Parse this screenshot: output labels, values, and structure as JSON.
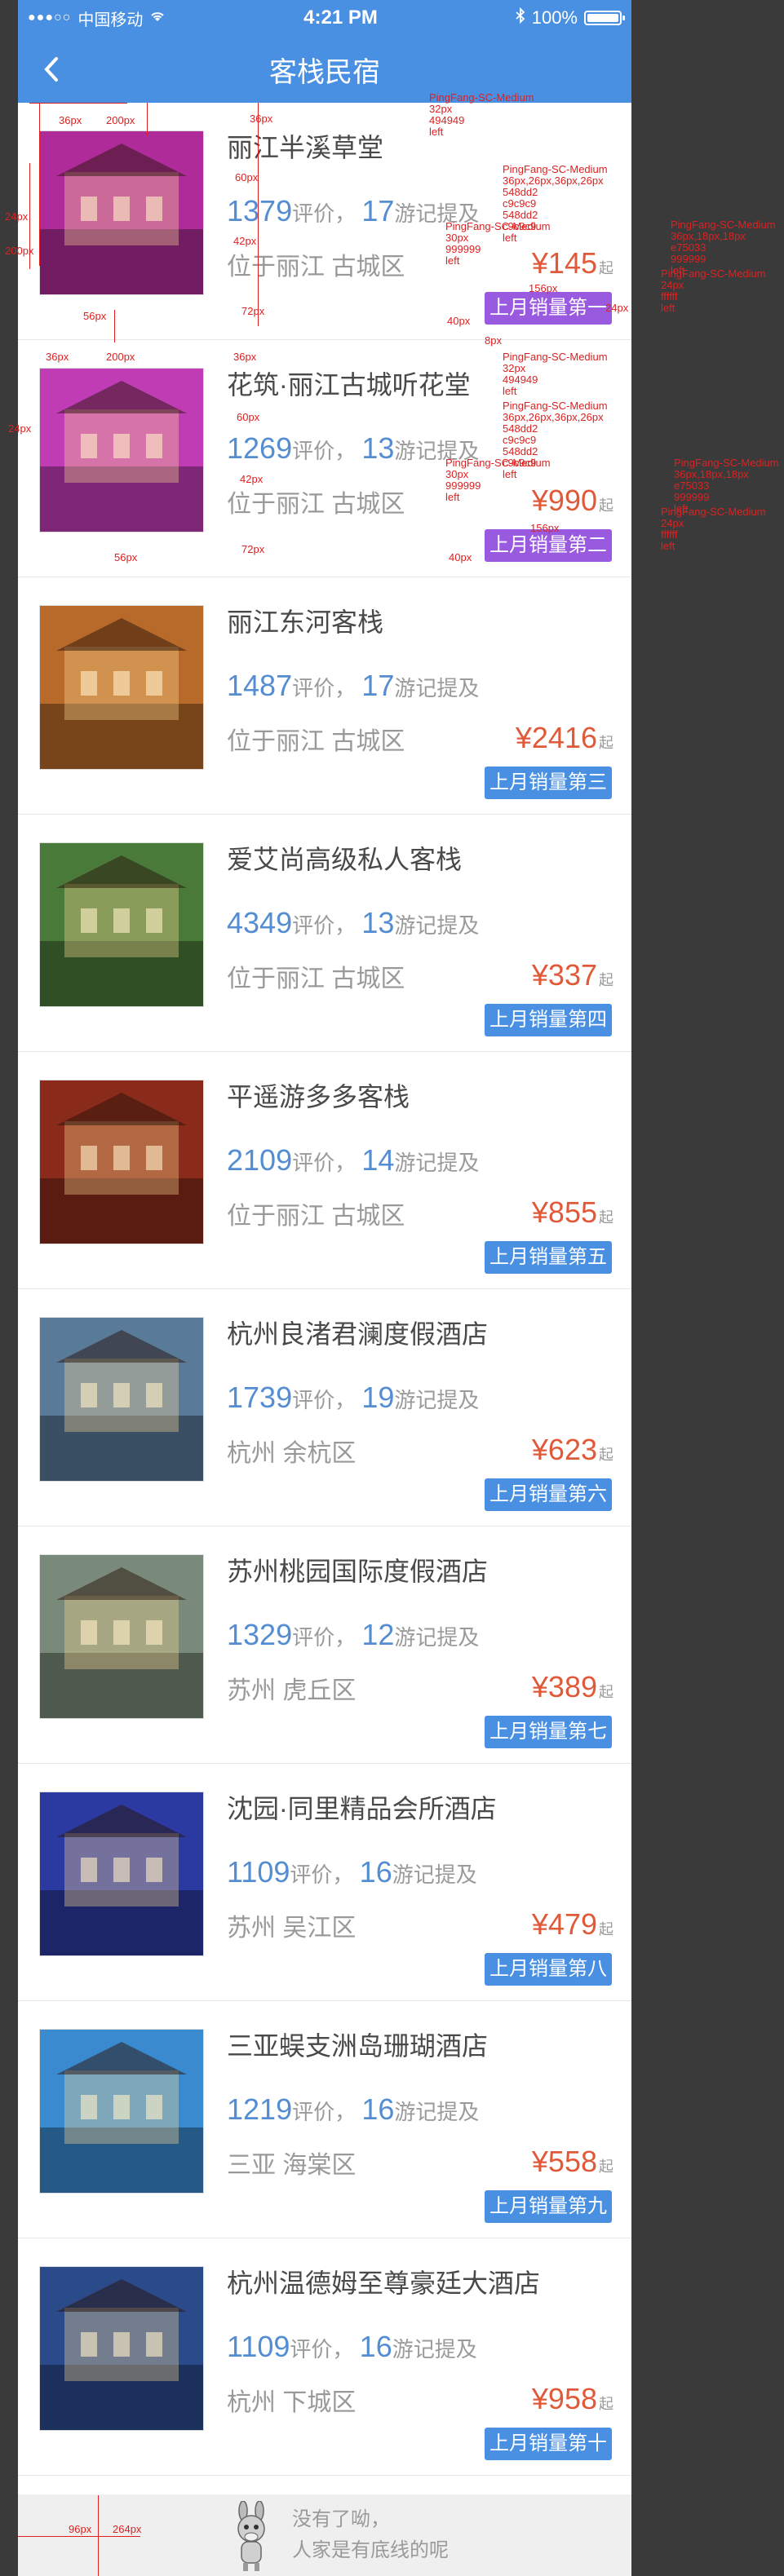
{
  "status_bar": {
    "carrier": "中国移动",
    "time": "4:21 PM",
    "battery": "100%"
  },
  "nav": {
    "back_icon": "chevron-left-icon",
    "title": "客栈民宿"
  },
  "items": [
    {
      "name": "丽江半溪草堂",
      "reviews": "1379",
      "review_label": "评价，",
      "mentions": "17",
      "mention_label": "游记提及",
      "location": "位于丽江 古城区",
      "price": "¥145",
      "unit": "起",
      "badge": "上月销量第一",
      "theme": "#b02b9a"
    },
    {
      "name": "花筑·丽江古城听花堂",
      "reviews": "1269",
      "review_label": "评价，",
      "mentions": "13",
      "mention_label": "游记提及",
      "location": "位于丽江 古城区",
      "price": "¥990",
      "unit": "起",
      "badge": "上月销量第二",
      "theme": "#c03cb5"
    },
    {
      "name": "丽江东河客栈",
      "reviews": "1487",
      "review_label": "评价，",
      "mentions": "17",
      "mention_label": "游记提及",
      "location": "位于丽江 古城区",
      "price": "¥2416",
      "unit": "起",
      "badge": "上月销量第三",
      "theme": "#b86a2a"
    },
    {
      "name": "爱艾尚高级私人客栈",
      "reviews": "4349",
      "review_label": "评价，",
      "mentions": "13",
      "mention_label": "游记提及",
      "location": "位于丽江 古城区",
      "price": "¥337",
      "unit": "起",
      "badge": "上月销量第四",
      "theme": "#4a7a3a"
    },
    {
      "name": "平遥游多多客栈",
      "reviews": "2109",
      "review_label": "评价，",
      "mentions": "14",
      "mention_label": "游记提及",
      "location": "位于丽江 古城区",
      "price": "¥855",
      "unit": "起",
      "badge": "上月销量第五",
      "theme": "#8a2a1a"
    },
    {
      "name": "杭州良渚君澜度假酒店",
      "reviews": "1739",
      "review_label": "评价，",
      "mentions": "19",
      "mention_label": "游记提及",
      "location": "杭州 余杭区",
      "price": "¥623",
      "unit": "起",
      "badge": "上月销量第六",
      "theme": "#5a7a9a"
    },
    {
      "name": "苏州桃园国际度假酒店",
      "reviews": "1329",
      "review_label": "评价，",
      "mentions": "12",
      "mention_label": "游记提及",
      "location": "苏州 虎丘区",
      "price": "¥389",
      "unit": "起",
      "badge": "上月销量第七",
      "theme": "#7a8a7a"
    },
    {
      "name": "沈园·同里精品会所酒店",
      "reviews": "1109",
      "review_label": "评价，",
      "mentions": "16",
      "mention_label": "游记提及",
      "location": "苏州 吴江区",
      "price": "¥479",
      "unit": "起",
      "badge": "上月销量第八",
      "theme": "#2a3aa0"
    },
    {
      "name": "三亚蜈支洲岛珊瑚酒店",
      "reviews": "1219",
      "review_label": "评价，",
      "mentions": "16",
      "mention_label": "游记提及",
      "location": "三亚 海棠区",
      "price": "¥558",
      "unit": "起",
      "badge": "上月销量第九",
      "theme": "#3a8ad0"
    },
    {
      "name": "杭州温德姆至尊豪廷大酒店",
      "reviews": "1109",
      "review_label": "评价，",
      "mentions": "16",
      "mention_label": "游记提及",
      "location": "杭州 下城区",
      "price": "¥958",
      "unit": "起",
      "badge": "上月销量第十",
      "theme": "#2a4a8a"
    }
  ],
  "footer": {
    "line1": "没有了呦，",
    "line2": "人家是有底线的呢"
  },
  "annotations": {
    "dims": [
      "36px",
      "200px",
      "36px",
      "60px",
      "42px",
      "72px",
      "24px",
      "200px",
      "56px",
      "40px",
      "24px",
      "8px",
      "156px",
      "36px",
      "200px",
      "36px",
      "60px",
      "42px",
      "72px",
      "24px",
      "56px",
      "40px",
      "156px",
      "96px",
      "264px"
    ],
    "specs": [
      [
        "PingFang-SC-Medium",
        "32px",
        "494949",
        "left"
      ],
      [
        "PingFang-SC-Medium",
        "36px,26px,36px,26px",
        "548dd2",
        "c9c9c9",
        "548dd2",
        "c9c9c9",
        "left"
      ],
      [
        "PingFang-SC-Medium",
        "30px",
        "999999",
        "left"
      ],
      [
        "PingFang-SC-Medium",
        "36px,18px,18px",
        "e75033",
        "999999",
        "left"
      ],
      [
        "PingFang-SC-Medium",
        "24px",
        "ffffff",
        "left"
      ]
    ]
  }
}
